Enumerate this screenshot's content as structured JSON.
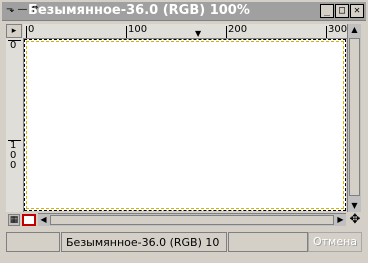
{
  "window": {
    "title": "Безымянное-36.0 (RGB) 100%",
    "icons": "⬎ — ⤊",
    "controls": {
      "minimize": "_",
      "maximize": "□",
      "close": "✕"
    }
  },
  "rulers": {
    "top_labels": [
      "0",
      "100",
      "200",
      "300"
    ],
    "left_labels": [
      "0",
      "1",
      "0",
      "0"
    ]
  },
  "status": {
    "image_name": "Безымянное-36.0 (RGB) 10",
    "cancel_label": "Отмена"
  },
  "colors": {
    "titlebar": "#a0a0a0",
    "accent": "#c00000"
  }
}
